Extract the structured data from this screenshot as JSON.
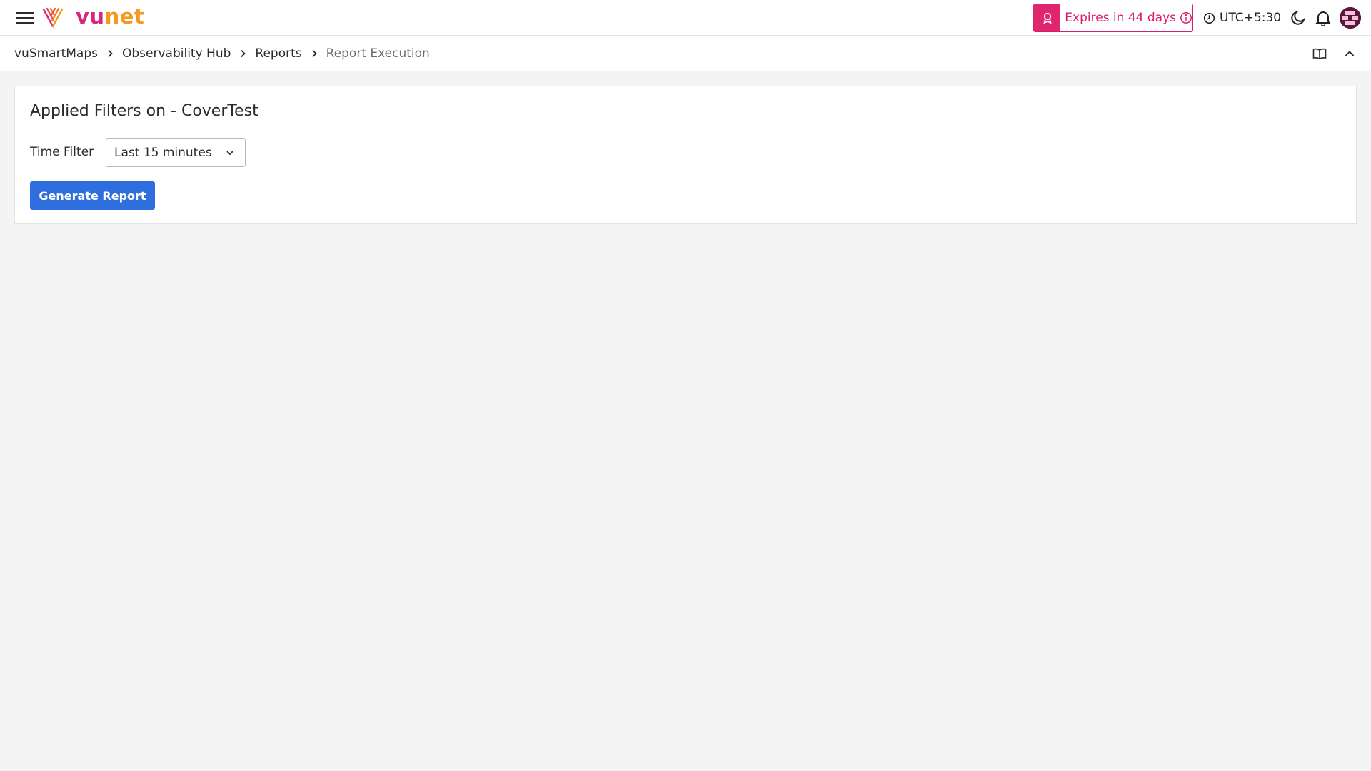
{
  "header": {
    "menu_icon": "hamburger-icon",
    "logo": {
      "part1": "vu",
      "part2": "net",
      "colors": {
        "vu": "#d8267c",
        "net": "#f39a1e"
      }
    },
    "expiry": {
      "label": "Expires in 44 days",
      "icon": "badge-icon",
      "info_icon": "info-icon",
      "color": "#d81d6e"
    },
    "timezone": {
      "label": "UTC+5:30",
      "icon": "clock-icon"
    },
    "theme_icon": "moon-icon",
    "notifications_icon": "bell-icon",
    "avatar_icon": "user-avatar"
  },
  "breadcrumb": {
    "items": [
      "vuSmartMaps",
      "Observability Hub",
      "Reports"
    ],
    "current": "Report Execution",
    "separator_icon": "chevron-right-icon",
    "right_icons": [
      "book-icon",
      "chevron-up-icon"
    ]
  },
  "card": {
    "title": "Applied Filters on - CoverTest",
    "time_filter": {
      "label": "Time Filter",
      "value": "Last 15 minutes",
      "icon": "chevron-down-icon"
    },
    "generate_button": "Generate Report",
    "accent_color": "#2f6fdd"
  }
}
